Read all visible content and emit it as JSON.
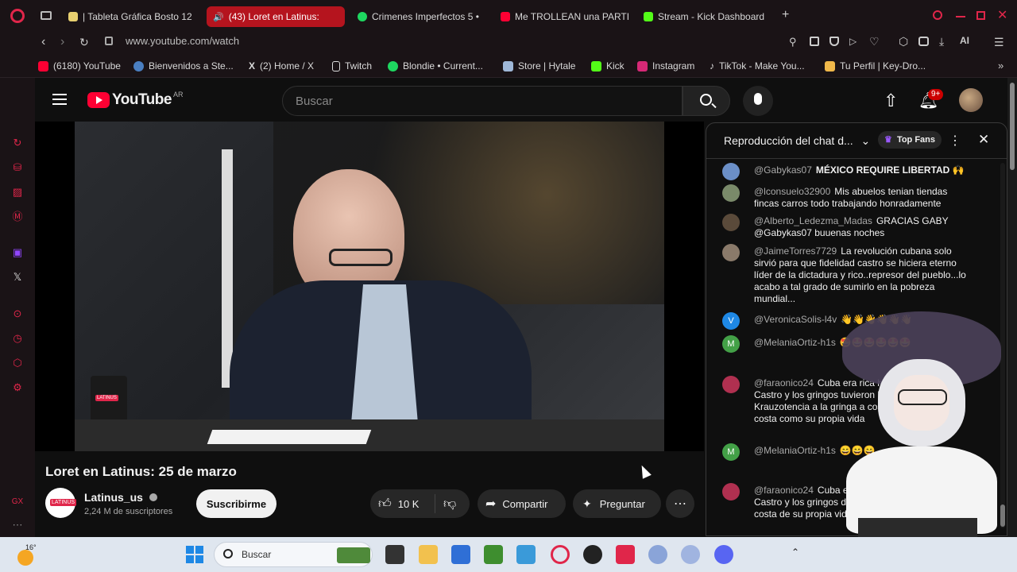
{
  "browser": {
    "tabs": [
      {
        "label": "| Tableta Gráfica Bosto 12",
        "color": "#e8d070"
      },
      {
        "label": "(43) Loret en Latinus:",
        "color": "#ffffff"
      },
      {
        "label": "Crimenes Imperfectos 5 •",
        "color": "#1ed760"
      },
      {
        "label": "Me TROLLEAN una PARTI",
        "color": "#ff0033"
      },
      {
        "label": "Stream - Kick Dashboard",
        "color": "#53fc18"
      }
    ],
    "new_tab_label": "+",
    "url": "www.youtube.com/watch",
    "ai_label": "AI",
    "bookmarks": [
      {
        "label": "(6180) YouTube",
        "color": "#ff0033"
      },
      {
        "label": "Bienvenidos a Ste...",
        "color": "#4a7fc1"
      },
      {
        "label": "(2) Home / X",
        "color": "#ffffff"
      },
      {
        "label": "Twitch",
        "color": "#e8e8e8"
      },
      {
        "label": "Blondie • Current...",
        "color": "#1ed760"
      },
      {
        "label": "Store | Hytale",
        "color": "#9fb8d8"
      },
      {
        "label": "Kick",
        "color": "#53fc18"
      },
      {
        "label": "Instagram",
        "color": "#d62976"
      },
      {
        "label": "TikTok - Make You...",
        "color": "#ffffff"
      },
      {
        "label": "Tu Perfil | Key-Dro...",
        "color": "#f0b84a"
      }
    ]
  },
  "youtube": {
    "logo_text": "YouTube",
    "country": "AR",
    "search_placeholder": "Buscar",
    "notif_count": "9+",
    "video_title": "Loret en Latinus: 25 de marzo",
    "mug_text": "LATINUS",
    "channel_name": "Latinus_us",
    "channel_avatar_text": "LATINUS",
    "subscribers": "2,24 M de suscriptores",
    "subscribe_label": "Suscribirme",
    "likes": "10 K",
    "share_label": "Compartir",
    "ask_label": "Preguntar"
  },
  "chat": {
    "title": "Reproducción del chat d...",
    "top_fans_label": "Top Fans",
    "messages": [
      {
        "author": "@Gabykas07",
        "text": "MÉXICO REQUIRE LIBERTAD 🙌",
        "avatar": "",
        "avatar_color": "#6b8fc7"
      },
      {
        "author": "@lconsuelo32900",
        "text": "Mis abuelos tenian tiendas fincas carros todo trabajando honradamente",
        "avatar": "",
        "avatar_color": "#7a8a6a"
      },
      {
        "author": "@Alberto_Ledezma_Madas",
        "text": "GRACIAS GABY @Gabykas07 buuenas noches",
        "avatar": "",
        "avatar_color": "#5a4a3a"
      },
      {
        "author": "@JaimeTorres7729",
        "text": "La revolución cubana solo sirvió para que fidelidad castro se hiciera eterno líder de la dictadura y rico..represor del pueblo...lo acabo a tal grado de sumirlo en la pobreza mundial...",
        "avatar": "",
        "avatar_color": "#8a7a6a"
      },
      {
        "author": "@VeronicaSolis-l4v",
        "text": "👋👋👋👋👋👋",
        "avatar": "V",
        "avatar_color": "#1e88e5"
      },
      {
        "author": "@MelaniaOrtiz-h1s",
        "text": "🤩🤩🤩🤩🤩🤩",
        "avatar": "M",
        "avatar_color": "#43a047"
      },
      {
        "author": "@faraonico24",
        "text": "Cuba era rica hasta que llegó Castro y los gringos tuvieron la defensa que hace Krauzotencia a la gringa a costa del pueblo, a costa como su propia vida",
        "avatar": "",
        "avatar_color": "#b03050"
      },
      {
        "author": "@MelaniaOrtiz-h1s",
        "text": "😄😄😄",
        "avatar": "M",
        "avatar_color": "#43a047"
      },
      {
        "author": "@faraonico24",
        "text": "Cuba era rica hasta que llegó Castro y los gringos defensa que hace gringa a costa de su propia vida",
        "avatar": "",
        "avatar_color": "#b03050"
      }
    ]
  },
  "taskbar": {
    "weather": "16°",
    "search_label": "Buscar"
  }
}
